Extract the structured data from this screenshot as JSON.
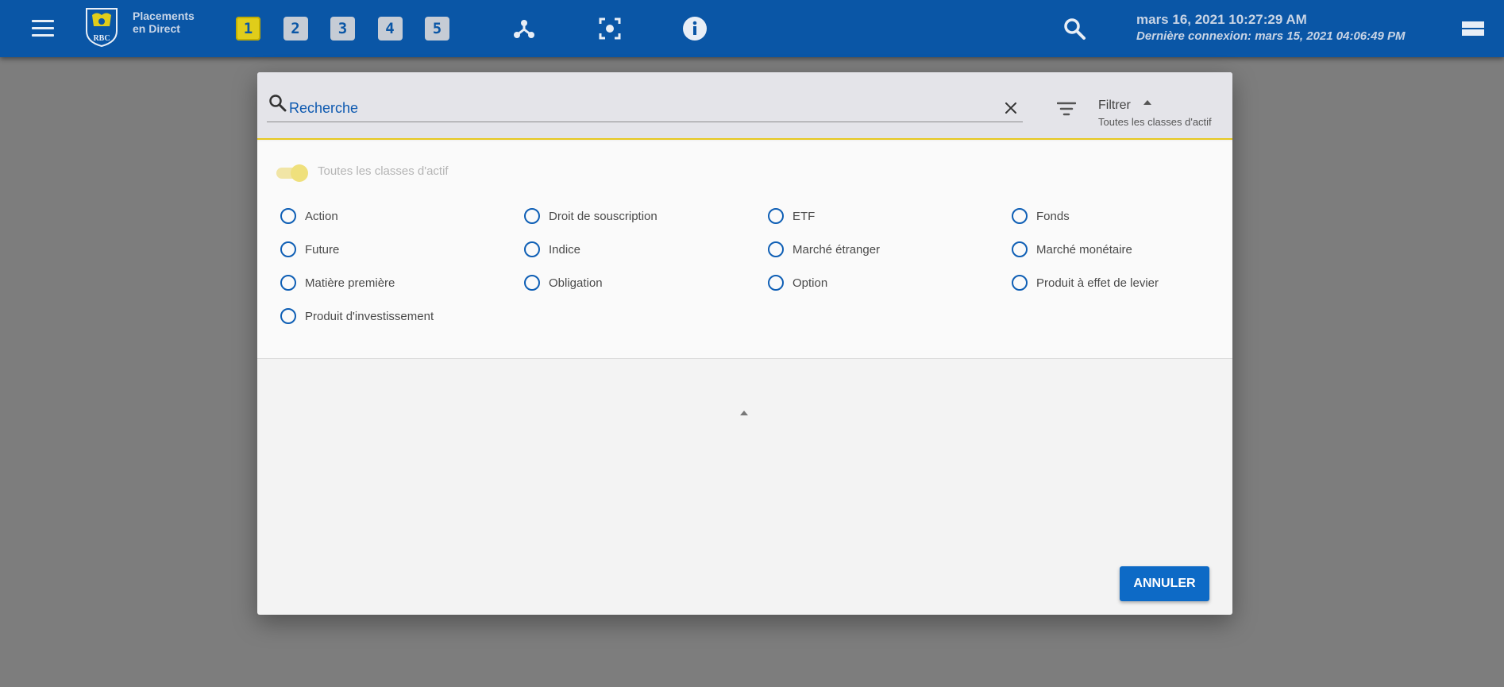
{
  "header": {
    "brand_line1": "Placements",
    "brand_line2": "en Direct",
    "logo_text": "RBC",
    "workspace_tabs": [
      "1",
      "2",
      "3",
      "4",
      "5"
    ],
    "active_tab": "1",
    "datetime_now": "mars 16, 2021 10:27:29 AM",
    "last_login": "Dernière connexion: mars 15, 2021 04:06:49 PM",
    "icons": [
      "menu-icon",
      "network-icon",
      "focus-icon",
      "info-icon",
      "search-icon",
      "menu-collapse-icon"
    ]
  },
  "dialog": {
    "search": {
      "placeholder": "Recherche",
      "value": ""
    },
    "filter": {
      "title": "Filtrer",
      "subtitle": "Toutes les classes d'actif"
    },
    "toggle": {
      "label": "Toutes les classes d'actif",
      "on": true
    },
    "asset_classes": [
      "Action",
      "Droit de souscription",
      "ETF",
      "Fonds",
      "Future",
      "Indice",
      "Marché étranger",
      "Marché monétaire",
      "Matière première",
      "Obligation",
      "Option",
      "Produit à effet de levier",
      "Produit d'investissement"
    ],
    "cancel_label": "ANNULER"
  },
  "colors": {
    "primary": "#0a56a6",
    "accent_yellow": "#e6c81f",
    "radio_blue": "#0f5fb5",
    "button_blue": "#0d6ac6"
  }
}
